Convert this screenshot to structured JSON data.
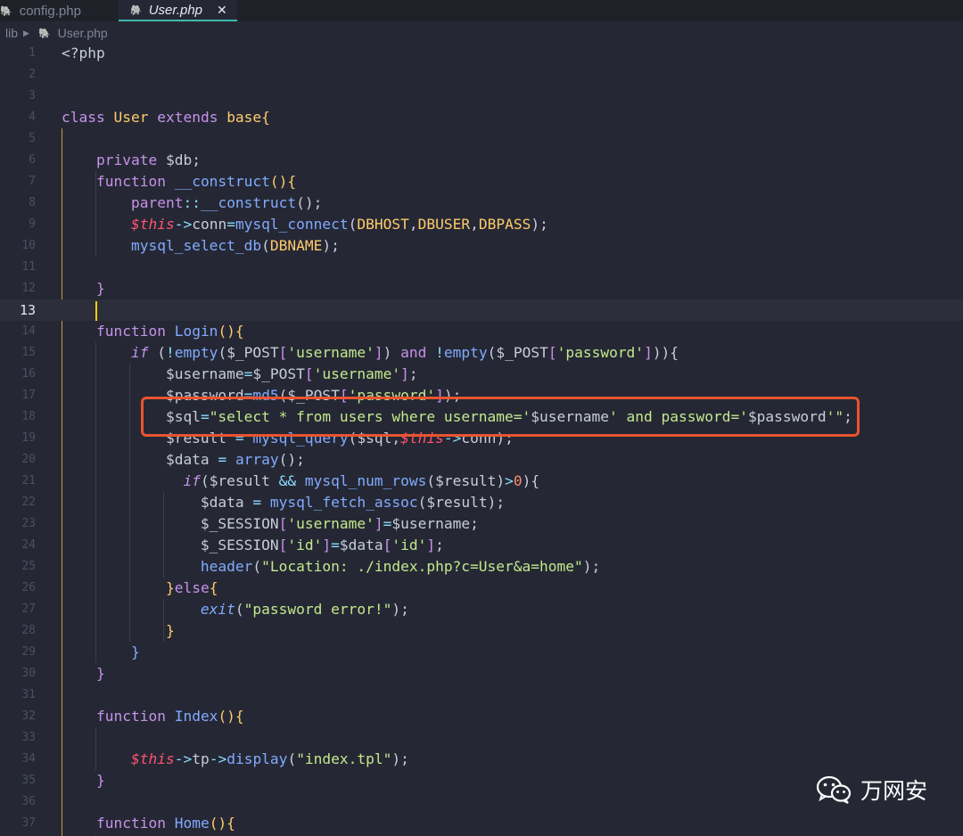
{
  "tabs": [
    {
      "label": "config.php",
      "icon": "php-elephant-icon",
      "active": false
    },
    {
      "label": "User.php",
      "icon": "php-elephant-icon",
      "active": true,
      "close": "✕"
    }
  ],
  "breadcrumb": {
    "folder": "lib",
    "file": "User.php"
  },
  "editor": {
    "current_line": 13,
    "lines": [
      {
        "n": "1",
        "t": [
          [
            "pl",
            "<?php"
          ]
        ]
      },
      {
        "n": "2",
        "t": []
      },
      {
        "n": "3",
        "t": []
      },
      {
        "n": "4",
        "t": [
          [
            "k",
            "class "
          ],
          [
            "cls",
            "User "
          ],
          [
            "k",
            "extends "
          ],
          [
            "cls",
            "base"
          ],
          [
            "br",
            "{"
          ]
        ]
      },
      {
        "n": "5",
        "t": []
      },
      {
        "n": "6",
        "t": [
          [
            "k",
            "    private "
          ],
          [
            "var",
            "$db"
          ],
          [
            "pl",
            ";"
          ]
        ]
      },
      {
        "n": "7",
        "t": [
          [
            "k",
            "    function "
          ],
          [
            "fn",
            "__construct"
          ],
          [
            "br",
            "(){"
          ]
        ]
      },
      {
        "n": "8",
        "t": [
          [
            "k",
            "        parent"
          ],
          [
            "op",
            "::"
          ],
          [
            "fn",
            "__construct"
          ],
          [
            "pl",
            "();"
          ]
        ]
      },
      {
        "n": "9",
        "t": [
          [
            "th",
            "        $this"
          ],
          [
            "op",
            "->"
          ],
          [
            "pl",
            "conn"
          ],
          [
            "op",
            "="
          ],
          [
            "fn",
            "mysql_connect"
          ],
          [
            "pl",
            "("
          ],
          [
            "const",
            "DBHOST"
          ],
          [
            "pl",
            ","
          ],
          [
            "const",
            "DBUSER"
          ],
          [
            "pl",
            ","
          ],
          [
            "const",
            "DBPASS"
          ],
          [
            "pl",
            ");"
          ]
        ]
      },
      {
        "n": "10",
        "t": [
          [
            "fn",
            "        mysql_select_db"
          ],
          [
            "pl",
            "("
          ],
          [
            "const",
            "DBNAME"
          ],
          [
            "pl",
            ");"
          ]
        ]
      },
      {
        "n": "11",
        "t": []
      },
      {
        "n": "12",
        "t": [
          [
            "k",
            "    }"
          ]
        ]
      },
      {
        "n": "13",
        "t": []
      },
      {
        "n": "14",
        "t": [
          [
            "k",
            "    function "
          ],
          [
            "fn",
            "Login"
          ],
          [
            "br",
            "(){"
          ]
        ]
      },
      {
        "n": "15",
        "t": [
          [
            "kit",
            "        if "
          ],
          [
            "pl",
            "("
          ],
          [
            "op",
            "!"
          ],
          [
            "fn",
            "empty"
          ],
          [
            "pl",
            "("
          ],
          [
            "var",
            "$_POST"
          ],
          [
            "k",
            "["
          ],
          [
            "str",
            "'username'"
          ],
          [
            "k",
            "]"
          ],
          [
            "pl",
            ") "
          ],
          [
            "k",
            "and "
          ],
          [
            "op",
            "!"
          ],
          [
            "fn",
            "empty"
          ],
          [
            "pl",
            "("
          ],
          [
            "var",
            "$_POST"
          ],
          [
            "k",
            "["
          ],
          [
            "str",
            "'password'"
          ],
          [
            "k",
            "]"
          ],
          [
            "pl",
            ")){"
          ]
        ]
      },
      {
        "n": "16",
        "t": [
          [
            "var",
            "            $username"
          ],
          [
            "op",
            "="
          ],
          [
            "var",
            "$_POST"
          ],
          [
            "k",
            "["
          ],
          [
            "str",
            "'username'"
          ],
          [
            "k",
            "]"
          ],
          [
            "pl",
            ";"
          ]
        ]
      },
      {
        "n": "17",
        "t": [
          [
            "var",
            "            $password"
          ],
          [
            "op",
            "="
          ],
          [
            "fn",
            "md5"
          ],
          [
            "pl",
            "("
          ],
          [
            "var",
            "$_POST"
          ],
          [
            "k",
            "["
          ],
          [
            "str",
            "'password'"
          ],
          [
            "k",
            "]"
          ],
          [
            "pl",
            ");"
          ]
        ]
      },
      {
        "n": "18",
        "t": [
          [
            "var",
            "            $sql"
          ],
          [
            "op",
            "="
          ],
          [
            "str",
            "\"select * from users where username='"
          ],
          [
            "var",
            "$username"
          ],
          [
            "str",
            "' and password='"
          ],
          [
            "var",
            "$password"
          ],
          [
            "str",
            "'\""
          ],
          [
            "pl",
            ";"
          ]
        ]
      },
      {
        "n": "19",
        "t": [
          [
            "var",
            "            $result "
          ],
          [
            "op",
            "= "
          ],
          [
            "fn",
            "mysql_query"
          ],
          [
            "pl",
            "("
          ],
          [
            "var",
            "$sql"
          ],
          [
            "pl",
            ","
          ],
          [
            "th",
            "$this"
          ],
          [
            "op",
            "->"
          ],
          [
            "pl",
            "conn);"
          ]
        ]
      },
      {
        "n": "20",
        "t": [
          [
            "var",
            "            $data "
          ],
          [
            "op",
            "= "
          ],
          [
            "fn",
            "array"
          ],
          [
            "pl",
            "();"
          ]
        ]
      },
      {
        "n": "21",
        "t": [
          [
            "kit",
            "              if"
          ],
          [
            "pl",
            "("
          ],
          [
            "var",
            "$result "
          ],
          [
            "op",
            "&& "
          ],
          [
            "fn",
            "mysql_num_rows"
          ],
          [
            "pl",
            "("
          ],
          [
            "var",
            "$result"
          ],
          [
            "pl",
            ")"
          ],
          [
            "op",
            ">"
          ],
          [
            "num",
            "0"
          ],
          [
            "pl",
            "){"
          ]
        ]
      },
      {
        "n": "22",
        "t": [
          [
            "var",
            "                $data "
          ],
          [
            "op",
            "= "
          ],
          [
            "fn",
            "mysql_fetch_assoc"
          ],
          [
            "pl",
            "("
          ],
          [
            "var",
            "$result"
          ],
          [
            "pl",
            ");"
          ]
        ]
      },
      {
        "n": "23",
        "t": [
          [
            "var",
            "                $_SESSION"
          ],
          [
            "k",
            "["
          ],
          [
            "str",
            "'username'"
          ],
          [
            "k",
            "]"
          ],
          [
            "op",
            "="
          ],
          [
            "var",
            "$username"
          ],
          [
            "pl",
            ";"
          ]
        ]
      },
      {
        "n": "24",
        "t": [
          [
            "var",
            "                $_SESSION"
          ],
          [
            "k",
            "["
          ],
          [
            "str",
            "'id'"
          ],
          [
            "k",
            "]"
          ],
          [
            "op",
            "="
          ],
          [
            "var",
            "$data"
          ],
          [
            "k",
            "["
          ],
          [
            "str",
            "'id'"
          ],
          [
            "k",
            "]"
          ],
          [
            "pl",
            ";"
          ]
        ]
      },
      {
        "n": "25",
        "t": [
          [
            "fn",
            "                header"
          ],
          [
            "pl",
            "("
          ],
          [
            "str",
            "\"Location: ./index.php?c=User&a=home\""
          ],
          [
            "pl",
            ");"
          ]
        ]
      },
      {
        "n": "26",
        "t": [
          [
            "br",
            "            }"
          ],
          [
            "k",
            "else"
          ],
          [
            "br",
            "{"
          ]
        ]
      },
      {
        "n": "27",
        "t": [
          [
            "it",
            "                exit"
          ],
          [
            "pl",
            "("
          ],
          [
            "str",
            "\"password error!\""
          ],
          [
            "pl",
            ");"
          ]
        ]
      },
      {
        "n": "28",
        "t": [
          [
            "br",
            "            }"
          ]
        ]
      },
      {
        "n": "29",
        "t": [
          [
            "fn",
            "        }"
          ]
        ]
      },
      {
        "n": "30",
        "t": [
          [
            "k",
            "    }"
          ]
        ]
      },
      {
        "n": "31",
        "t": []
      },
      {
        "n": "32",
        "t": [
          [
            "k",
            "    function "
          ],
          [
            "fn",
            "Index"
          ],
          [
            "br",
            "(){"
          ]
        ]
      },
      {
        "n": "33",
        "t": []
      },
      {
        "n": "34",
        "t": [
          [
            "th",
            "        $this"
          ],
          [
            "op",
            "->"
          ],
          [
            "pl",
            "tp"
          ],
          [
            "op",
            "->"
          ],
          [
            "fn",
            "display"
          ],
          [
            "pl",
            "("
          ],
          [
            "str",
            "\"index.tpl\""
          ],
          [
            "pl",
            ");"
          ]
        ]
      },
      {
        "n": "35",
        "t": [
          [
            "k",
            "    }"
          ]
        ]
      },
      {
        "n": "36",
        "t": []
      },
      {
        "n": "37",
        "t": [
          [
            "k",
            "    function "
          ],
          [
            "fn",
            "Home"
          ],
          [
            "br",
            "(){"
          ]
        ]
      }
    ]
  },
  "watermark": {
    "text": "万网安",
    "icon": "wechat-icon"
  },
  "colors": {
    "background": "#252834",
    "highlight_box": "#e8542f",
    "cursor": "#ffcc00"
  }
}
